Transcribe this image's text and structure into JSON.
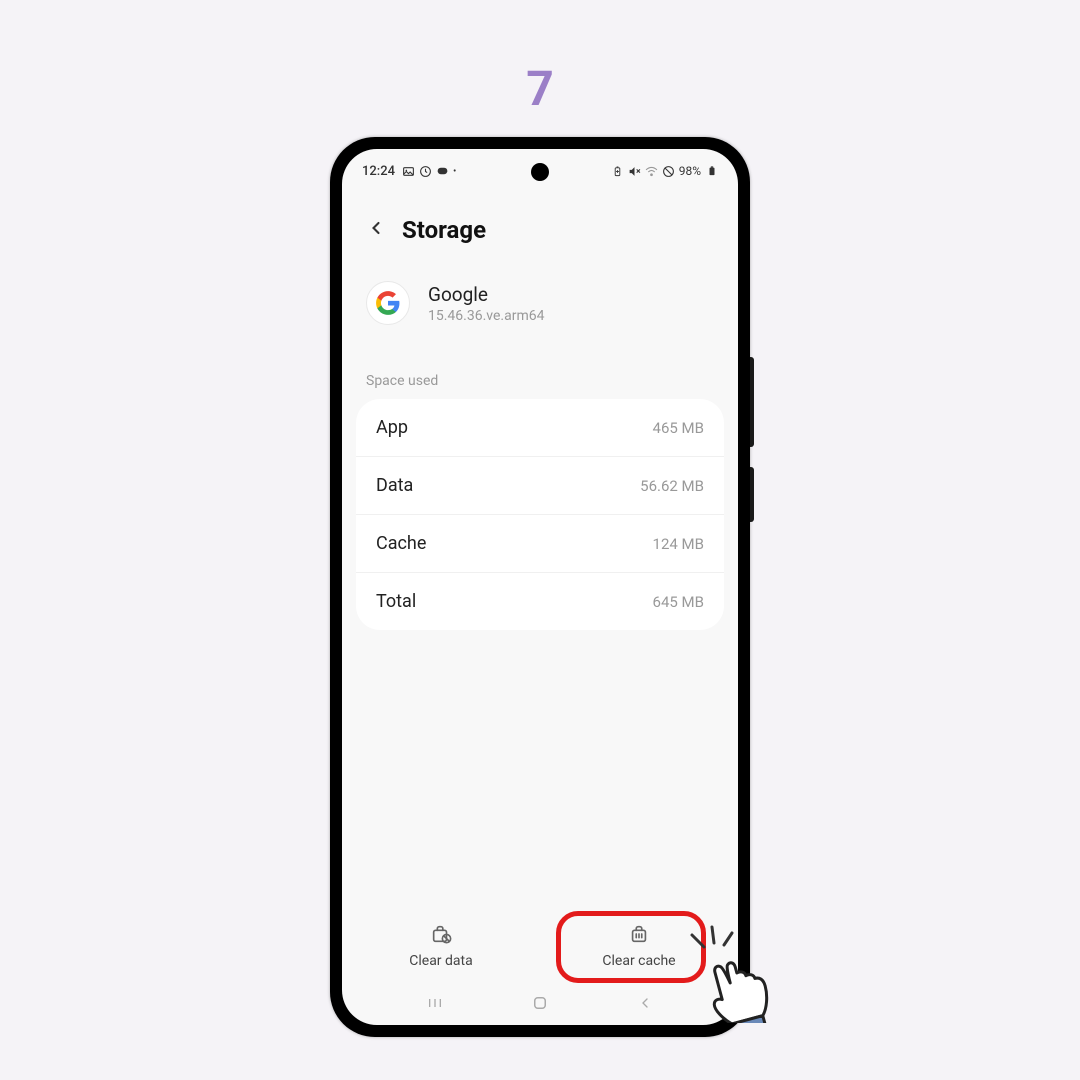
{
  "step_number": "7",
  "status_bar": {
    "time": "12:24",
    "battery": "98%"
  },
  "header": {
    "title": "Storage"
  },
  "app": {
    "name": "Google",
    "version": "15.46.36.ve.arm64"
  },
  "section_label": "Space used",
  "storage": {
    "rows": [
      {
        "label": "App",
        "value": "465 MB"
      },
      {
        "label": "Data",
        "value": "56.62 MB"
      },
      {
        "label": "Cache",
        "value": "124 MB"
      },
      {
        "label": "Total",
        "value": "645 MB"
      }
    ]
  },
  "actions": {
    "clear_data": "Clear data",
    "clear_cache": "Clear cache"
  }
}
